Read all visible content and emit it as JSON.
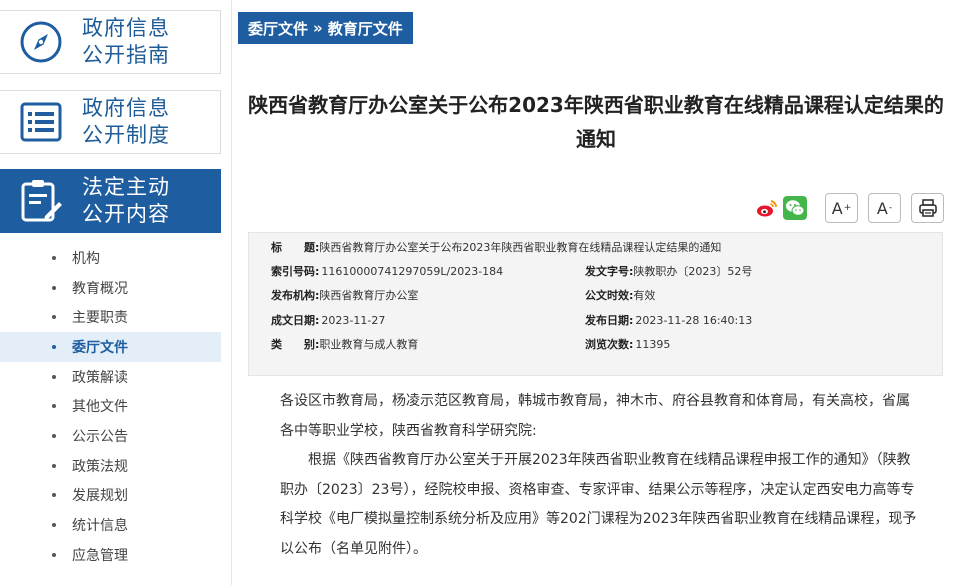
{
  "sidebar": {
    "cards": [
      {
        "label_line1": "政府信息",
        "label_line2": "公开指南",
        "icon": "compass-icon"
      },
      {
        "label_line1": "政府信息",
        "label_line2": "公开制度",
        "icon": "list-document-icon"
      },
      {
        "label_line1": "法定主动",
        "label_line2": "公开内容",
        "icon": "clipboard-edit-icon"
      }
    ],
    "items": [
      {
        "label": "机构"
      },
      {
        "label": "教育概况"
      },
      {
        "label": "主要职责"
      },
      {
        "label": "委厅文件",
        "active": true
      },
      {
        "label": "政策解读"
      },
      {
        "label": "其他文件"
      },
      {
        "label": "公示公告"
      },
      {
        "label": "政策法规"
      },
      {
        "label": "发展规划"
      },
      {
        "label": "统计信息"
      },
      {
        "label": "应急管理"
      }
    ]
  },
  "breadcrumb": {
    "part1": "委厅文件",
    "separator": "»",
    "part2": "教育厅文件"
  },
  "article": {
    "title_line1": "陕西省教育厅办公室关于公布2023年陕西省职业教育在线精品课程认定结果的",
    "title_line2": "通知"
  },
  "toolbar": {
    "font_increase": "A",
    "font_increase_sup": "+",
    "font_decrease": "A",
    "font_decrease_sup": "-"
  },
  "meta": {
    "title_key": "标　　题:",
    "title_val": "陕西省教育厅办公室关于公布2023年陕西省职业教育在线精品课程认定结果的通知",
    "index_key": "索引号码:",
    "index_val": "11610000741297059L/2023-184",
    "docno_key": "发文字号:",
    "docno_val": "陕教职办〔2023〕52号",
    "issuer_key": "发布机构:",
    "issuer_val": "陕西省教育厅办公室",
    "validity_key": "公文时效:",
    "validity_val": "有效",
    "written_key": "成文日期:",
    "written_val": "2023-11-27",
    "published_key": "发布日期:",
    "published_val": "2023-11-28 16:40:13",
    "category_key": "类　　别:",
    "category_val": "职业教育与成人教育",
    "views_key": "浏览次数:",
    "views_val": "11395"
  },
  "body": {
    "p1_line1": "各设区市教育局，杨凌示范区教育局，韩城市教育局，神木市、府谷县教育和体育局，有关高校，省属",
    "p1_line2": "各中等职业学校，陕西省教育科学研究院:",
    "p2_line1": "根据《陕西省教育厅办公室关于开展2023年陕西省职业教育在线精品课程申报工作的通知》（陕教",
    "p2_line2": "职办〔2023〕23号），经院校申报、资格审查、专家评审、结果公示等程序，决定认定西安电力高等专",
    "p2_line3": "科学校《电厂模拟量控制系统分析及应用》等202门课程为2023年陕西省职业教育在线精品课程，现予",
    "p2_line4": "以公布（名单见附件）。"
  },
  "colors": {
    "brand": "#1e5d9f",
    "meta_bg": "#f4f4f4",
    "active_nav_bg": "#e3eef8"
  }
}
